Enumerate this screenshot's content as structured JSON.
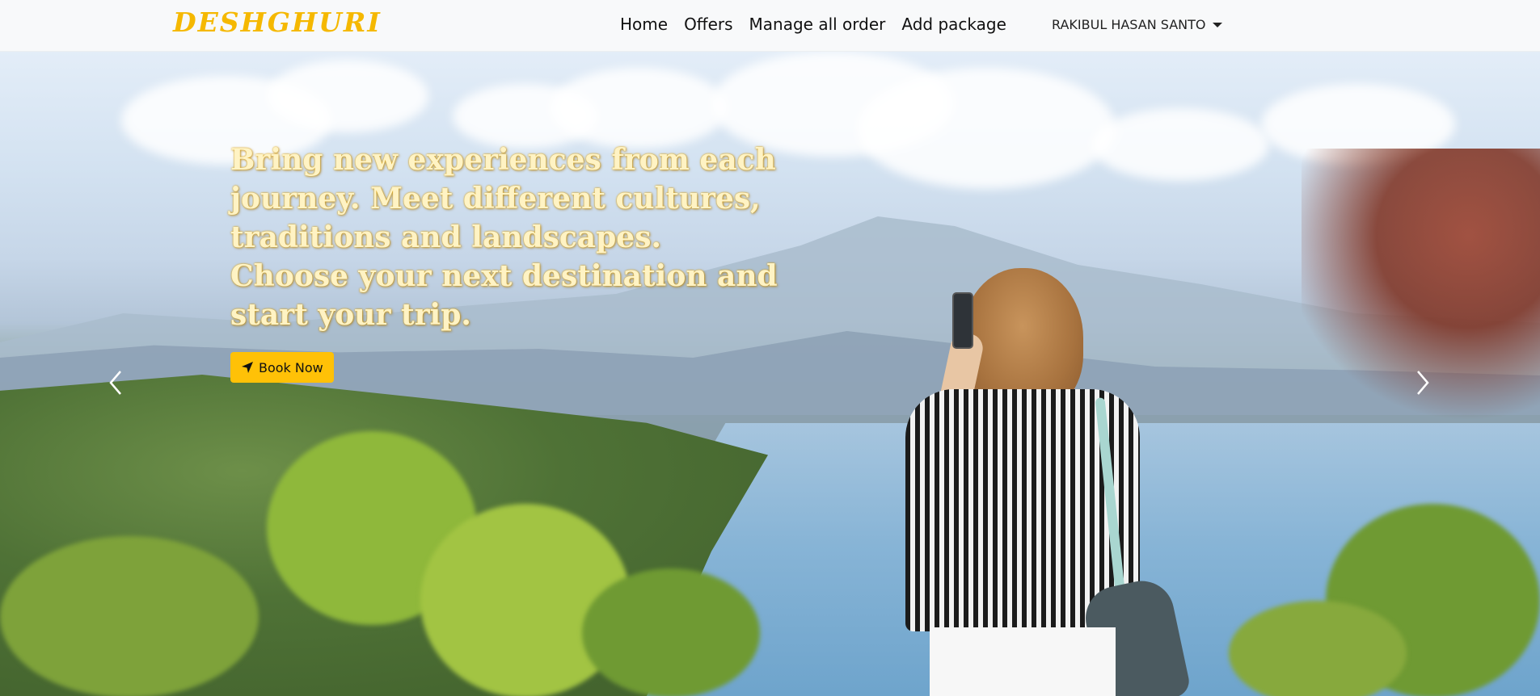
{
  "brand": {
    "name": "DESHGHURI",
    "color": "#f5b800"
  },
  "nav": {
    "links": [
      {
        "label": "Home"
      },
      {
        "label": "Offers"
      },
      {
        "label": "Manage all order"
      },
      {
        "label": "Add package"
      }
    ],
    "user": {
      "name": "RAKIBUL HASAN SANTO",
      "icon": "caret-down-icon"
    }
  },
  "hero": {
    "caption": "Bring new experiences from each journey. Meet different cultures, traditions and landscapes. Choose your next destination and start your trip.",
    "button": {
      "label": "Book Now",
      "icon": "location-arrow-icon",
      "color": "#ffc107"
    },
    "controls": {
      "prev_icon": "chevron-left-icon",
      "next_icon": "chevron-right-icon"
    }
  }
}
